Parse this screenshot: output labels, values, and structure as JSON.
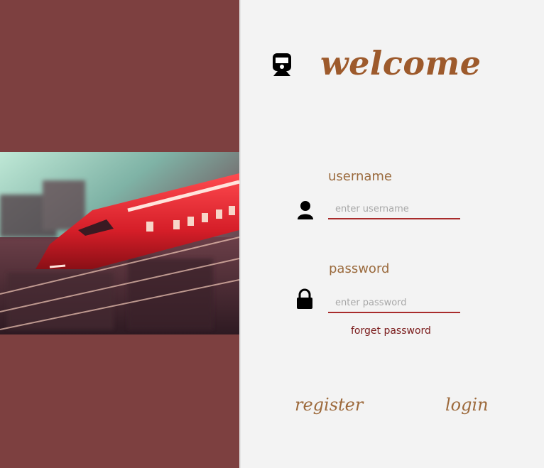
{
  "header": {
    "title": "welcome",
    "logo_icon": "train-icon"
  },
  "form": {
    "username": {
      "label": "username",
      "placeholder": "enter username",
      "value": "",
      "icon": "user-icon"
    },
    "password": {
      "label": "password",
      "placeholder": "enter password",
      "value": "",
      "icon": "lock-icon"
    },
    "forget_label": "forget password"
  },
  "actions": {
    "register_label": "register",
    "login_label": "login"
  },
  "colors": {
    "left_panel": "#7d4040",
    "accent": "#9d5a2c",
    "underline": "#a82b2b",
    "train": "#d8262c"
  }
}
